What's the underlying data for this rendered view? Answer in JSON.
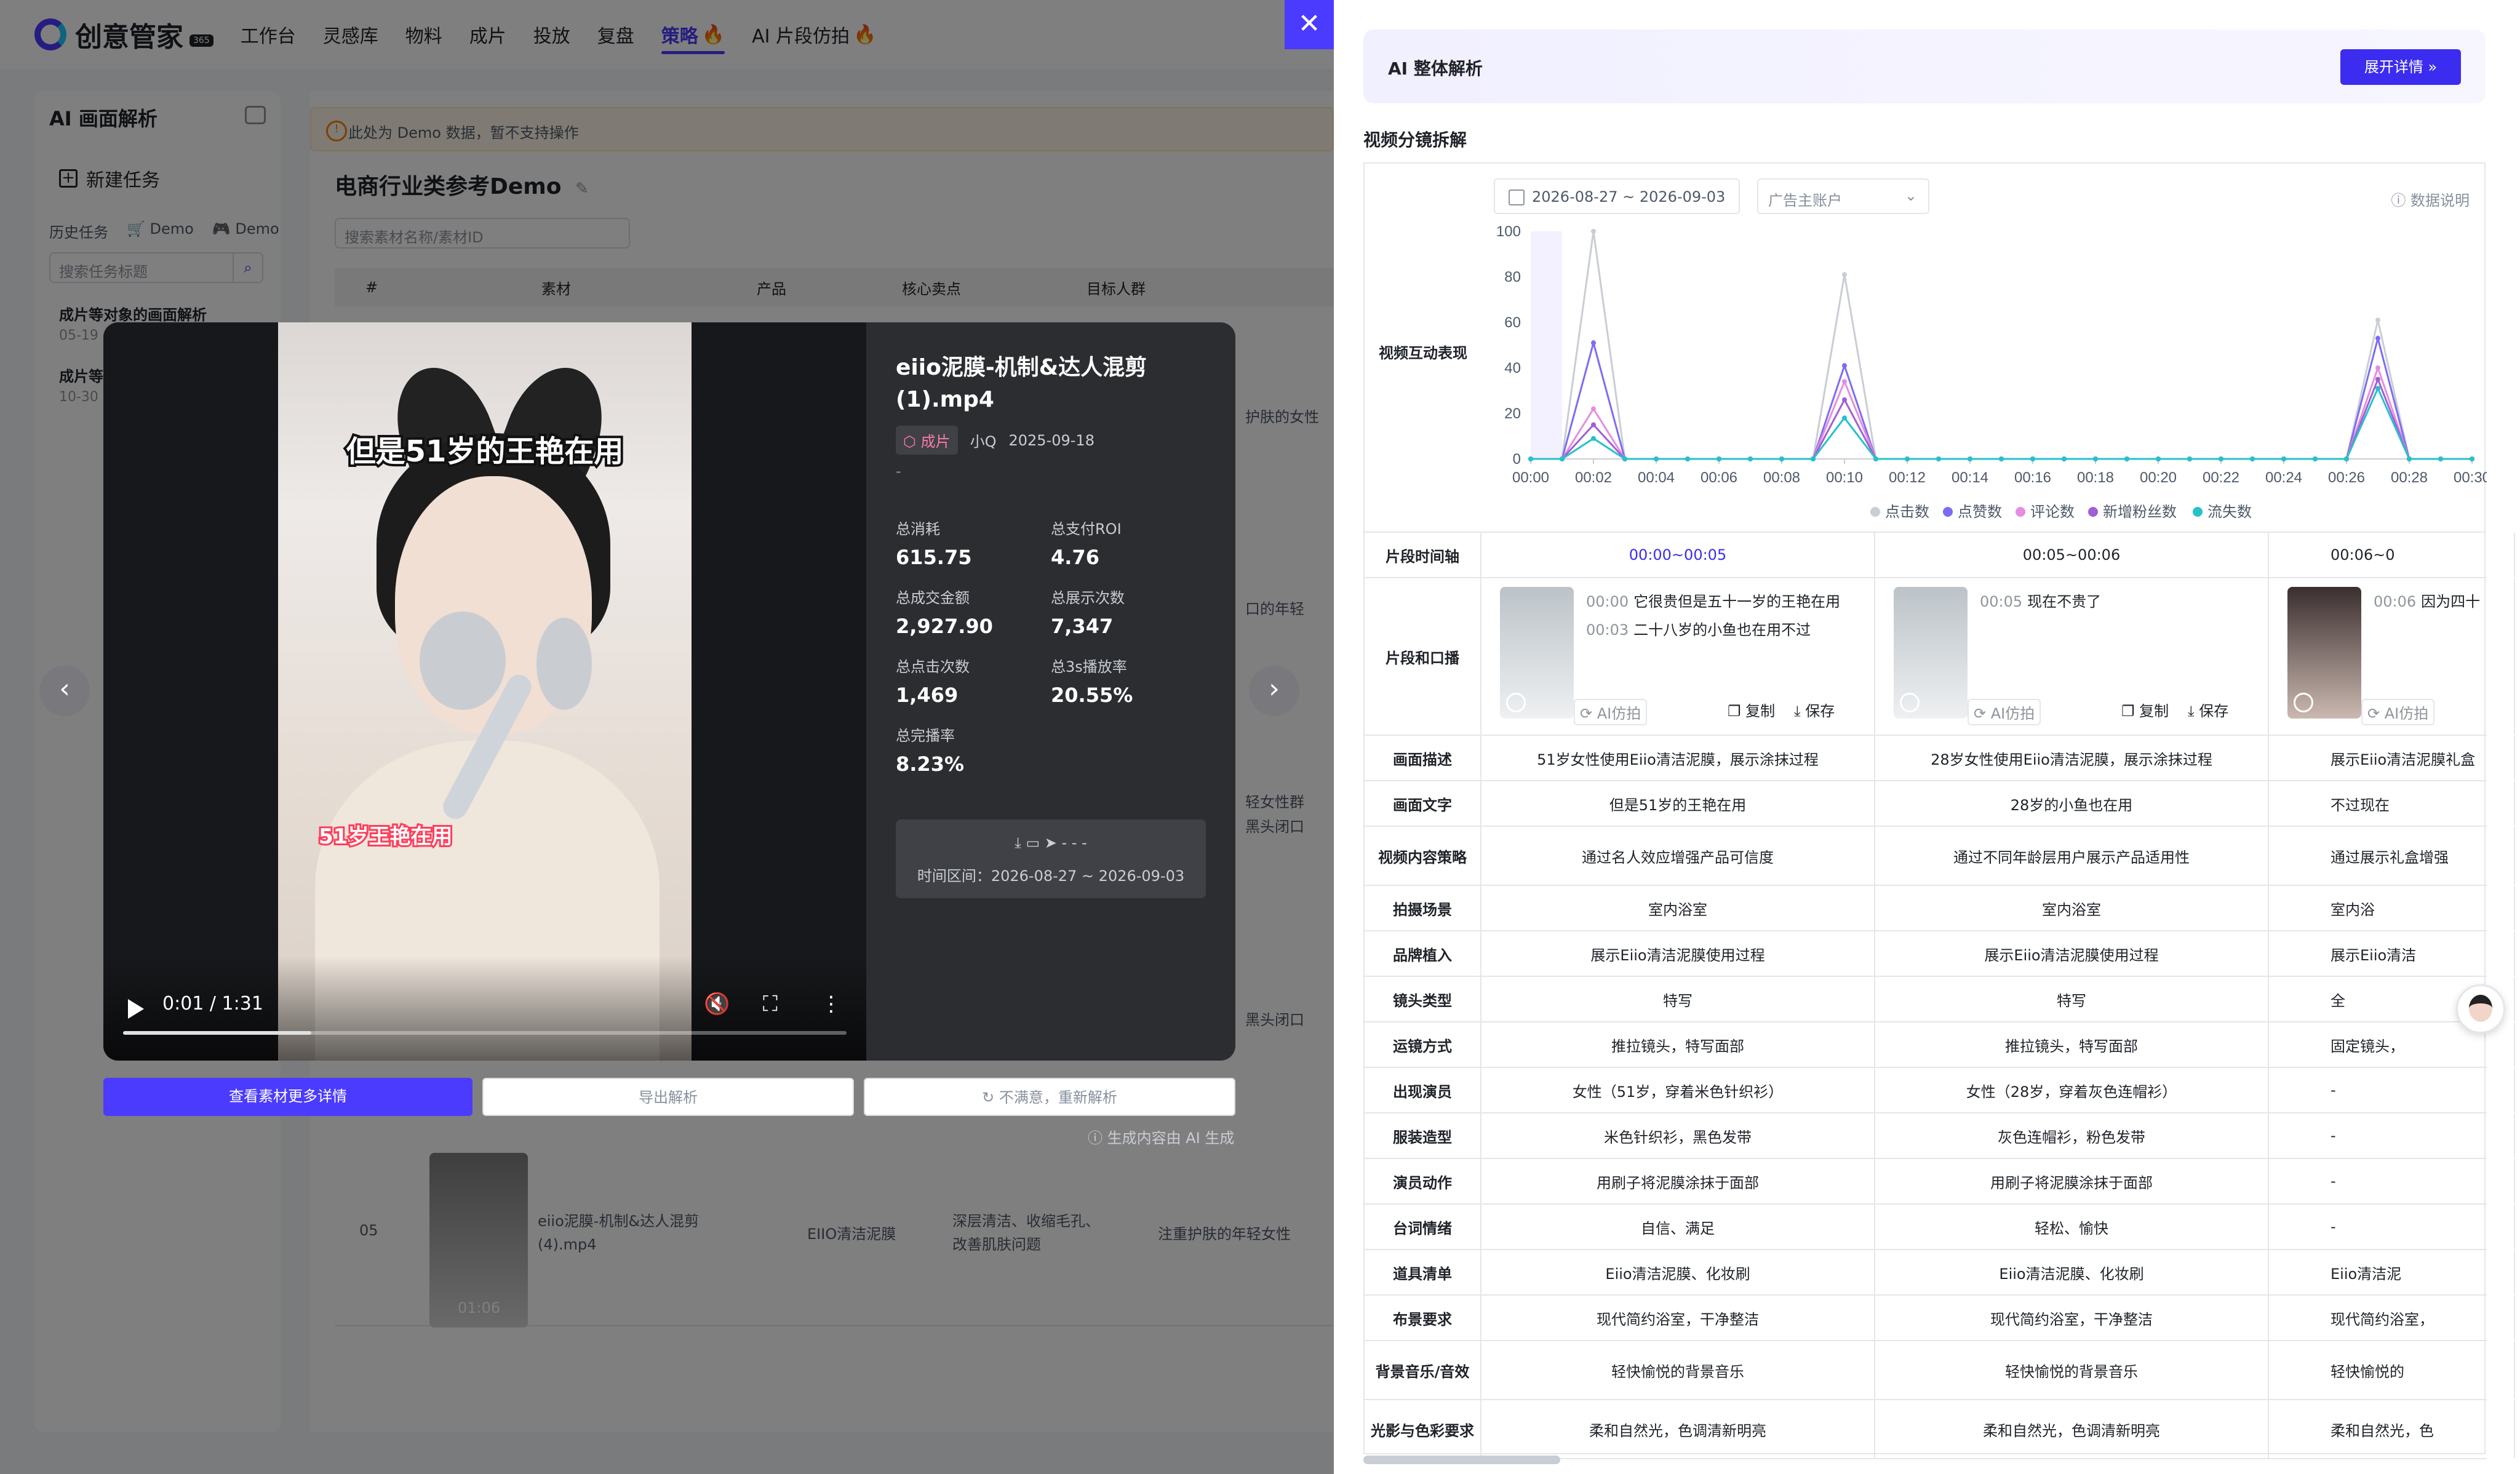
{
  "nav": {
    "logo_text": "创意管家",
    "logo_badge": "365",
    "items": [
      "工作台",
      "灵感库",
      "物料",
      "成片",
      "投放",
      "复盘",
      "策略",
      "AI 片段仿拍"
    ],
    "active_index": 6,
    "hot_indices": [
      6,
      7
    ]
  },
  "left_panel": {
    "title": "AI 画面解析",
    "new_task": "新建任务",
    "history_label": "历史任务",
    "filters": [
      "Demo",
      "Demo"
    ],
    "search_placeholder": "搜索任务标题",
    "tasks": [
      {
        "title": "成片等对象的画面解析",
        "date": "05-19"
      },
      {
        "title": "成片等",
        "date": "10-30"
      }
    ]
  },
  "main": {
    "notice": "此处为 Demo 数据，暂不支持操作",
    "title": "电商行业类参考Demo",
    "search_placeholder": "搜索素材名称/素材ID",
    "columns": [
      "#",
      "素材",
      "产品",
      "核心卖点",
      "目标人群"
    ],
    "row_snippets": [
      "护肤的女性",
      "口的年轻",
      "轻女性群",
      "黑头闭口",
      "黑头闭口"
    ],
    "row05": {
      "index": "05",
      "name": "eiio泥膜-机制&达人混剪 (4).mp4",
      "product": "EIIO清洁泥膜",
      "selling_point": "深层清洁、收缩毛孔、改善肌肤问题",
      "audience": "注重护肤的年轻女性",
      "duration": "01:06"
    }
  },
  "modal": {
    "video": {
      "caption_top": "但是51岁的王艳在用",
      "caption_bottom": "51岁王艳在用",
      "current_time": "0:01 / 1:31",
      "progress": 0.26
    },
    "title": "eiio泥膜-机制&达人混剪 (1).mp4",
    "tag": "成片",
    "author": "小Q",
    "date": "2025-09-18",
    "desc": "-",
    "stats": [
      {
        "label": "总消耗",
        "value": "615.75"
      },
      {
        "label": "总支付ROI",
        "value": "4.76"
      },
      {
        "label": "总成交金额",
        "value": "2,927.90"
      },
      {
        "label": "总展示次数",
        "value": "7,347"
      },
      {
        "label": "总点击次数",
        "value": "1,469"
      },
      {
        "label": "总3s播放率",
        "value": "20.55%"
      },
      {
        "label": "总完播率",
        "value": "8.23%"
      }
    ],
    "box_icons": "- - -",
    "time_range": "时间区间：2026-08-27 ~ 2026-09-03",
    "buttons": {
      "details": "查看素材更多详情",
      "export": "导出解析",
      "reanalyze": "不满意，重新解析"
    },
    "ai_note": "生成内容由 AI 生成"
  },
  "drawer": {
    "banner_title": "AI 整体解析",
    "banner_button": "展开详情",
    "section_title": "视频分镜拆解",
    "date_range": "2026-08-27 ~ 2026-09-03",
    "account_placeholder": "广告主账户",
    "data_explain": "数据说明",
    "chart_label": "视频互动表现",
    "timeline_label": "片段时间轴",
    "segments": [
      {
        "time": "00:00~00:05",
        "lines": [
          {
            "ts": "00:00",
            "text": "它很贵但是五十一岁的王艳在用"
          },
          {
            "ts": "00:03",
            "text": "二十八岁的小鱼也在用不过"
          }
        ]
      },
      {
        "time": "00:05~00:06",
        "lines": [
          {
            "ts": "00:05",
            "text": "现在不贵了"
          }
        ]
      },
      {
        "time": "00:06~0",
        "lines": [
          {
            "ts": "00:06",
            "text": "因为四十"
          }
        ]
      }
    ],
    "clip_label": "片段和口播",
    "actions": {
      "ai": "AI仿拍",
      "copy": "复制",
      "save": "保存"
    },
    "rows": [
      {
        "label": "画面描述",
        "cells": [
          "51岁女性使用Eiio清洁泥膜，展示涂抹过程",
          "28岁女性使用Eiio清洁泥膜，展示涂抹过程",
          "展示Eiio清洁泥膜礼盒"
        ]
      },
      {
        "label": "画面文字",
        "cells": [
          "但是51岁的王艳在用",
          "28岁的小鱼也在用",
          "不过现在"
        ]
      },
      {
        "label": "视频内容策略",
        "cells": [
          "通过名人效应增强产品可信度",
          "通过不同年龄层用户展示产品适用性",
          "通过展示礼盒增强"
        ]
      },
      {
        "label": "拍摄场景",
        "cells": [
          "室内浴室",
          "室内浴室",
          "室内浴"
        ]
      },
      {
        "label": "品牌植入",
        "cells": [
          "展示Eiio清洁泥膜使用过程",
          "展示Eiio清洁泥膜使用过程",
          "展示Eiio清洁"
        ]
      },
      {
        "label": "镜头类型",
        "cells": [
          "特写",
          "特写",
          "全"
        ]
      },
      {
        "label": "运镜方式",
        "cells": [
          "推拉镜头，特写面部",
          "推拉镜头，特写面部",
          "固定镜头，"
        ]
      },
      {
        "label": "出现演员",
        "cells": [
          "女性（51岁，穿着米色针织衫）",
          "女性（28岁，穿着灰色连帽衫）",
          "-"
        ]
      },
      {
        "label": "服装造型",
        "cells": [
          "米色针织衫，黑色发带",
          "灰色连帽衫，粉色发带",
          "-"
        ]
      },
      {
        "label": "演员动作",
        "cells": [
          "用刷子将泥膜涂抹于面部",
          "用刷子将泥膜涂抹于面部",
          "-"
        ]
      },
      {
        "label": "台词情绪",
        "cells": [
          "自信、满足",
          "轻松、愉快",
          "-"
        ]
      },
      {
        "label": "道具清单",
        "cells": [
          "Eiio清洁泥膜、化妆刷",
          "Eiio清洁泥膜、化妆刷",
          "Eiio清洁泥"
        ]
      },
      {
        "label": "布景要求",
        "cells": [
          "现代简约浴室，干净整洁",
          "现代简约浴室，干净整洁",
          "现代简约浴室，"
        ]
      },
      {
        "label": "背景音乐/音效",
        "cells": [
          "轻快愉悦的背景音乐",
          "轻快愉悦的背景音乐",
          "轻快愉悦的"
        ]
      },
      {
        "label": "光影与色彩要求",
        "cells": [
          "柔和自然光，色调清新明亮",
          "柔和自然光，色调清新明亮",
          "柔和自然光，色"
        ]
      }
    ]
  },
  "chart_data": {
    "type": "line",
    "x": [
      "00:00",
      "00:01",
      "00:02",
      "00:03",
      "00:04",
      "00:05",
      "00:06",
      "00:07",
      "00:08",
      "00:09",
      "00:10",
      "00:11",
      "00:12",
      "00:13",
      "00:14",
      "00:15",
      "00:16",
      "00:17",
      "00:18",
      "00:19",
      "00:20",
      "00:21",
      "00:22",
      "00:23",
      "00:24",
      "00:25",
      "00:26",
      "00:27",
      "00:28",
      "00:29",
      "00:30"
    ],
    "x_tick_labels": [
      "00:00",
      "00:02",
      "00:04",
      "00:06",
      "00:08",
      "00:10",
      "00:12",
      "00:14",
      "00:16",
      "00:18",
      "00:20",
      "00:22",
      "00:24",
      "00:26",
      "00:28",
      "00:30"
    ],
    "ylim": [
      0,
      100
    ],
    "y_ticks": [
      0,
      20,
      40,
      60,
      80,
      100
    ],
    "series": [
      {
        "name": "点击数",
        "color": "#c9cdd4",
        "values": [
          0,
          0,
          100,
          0,
          0,
          0,
          0,
          0,
          0,
          0,
          81,
          0,
          0,
          0,
          0,
          0,
          0,
          0,
          0,
          0,
          0,
          0,
          0,
          0,
          0,
          0,
          0,
          61,
          0,
          0,
          0
        ]
      },
      {
        "name": "点赞数",
        "color": "#7b6cf6",
        "values": [
          0,
          0,
          51,
          0,
          0,
          0,
          0,
          0,
          0,
          0,
          41,
          0,
          0,
          0,
          0,
          0,
          0,
          0,
          0,
          0,
          0,
          0,
          0,
          0,
          0,
          0,
          0,
          53,
          0,
          0,
          0
        ]
      },
      {
        "name": "评论数",
        "color": "#e58de0",
        "values": [
          0,
          0,
          22,
          0,
          0,
          0,
          0,
          0,
          0,
          0,
          34,
          0,
          0,
          0,
          0,
          0,
          0,
          0,
          0,
          0,
          0,
          0,
          0,
          0,
          0,
          0,
          0,
          40,
          0,
          0,
          0
        ]
      },
      {
        "name": "新增粉丝数",
        "color": "#a05fd6",
        "values": [
          0,
          0,
          15,
          0,
          0,
          0,
          0,
          0,
          0,
          0,
          26,
          0,
          0,
          0,
          0,
          0,
          0,
          0,
          0,
          0,
          0,
          0,
          0,
          0,
          0,
          0,
          0,
          35,
          0,
          0,
          0
        ]
      },
      {
        "name": "流失数",
        "color": "#25c2c9",
        "values": [
          0,
          0,
          9,
          0,
          0,
          0,
          0,
          0,
          0,
          0,
          18,
          0,
          0,
          0,
          0,
          0,
          0,
          0,
          0,
          0,
          0,
          0,
          0,
          0,
          0,
          0,
          0,
          31,
          0,
          0,
          0
        ]
      }
    ],
    "highlight_range": [
      "00:00",
      "00:01"
    ],
    "legend_position": "bottom",
    "grid": false
  }
}
